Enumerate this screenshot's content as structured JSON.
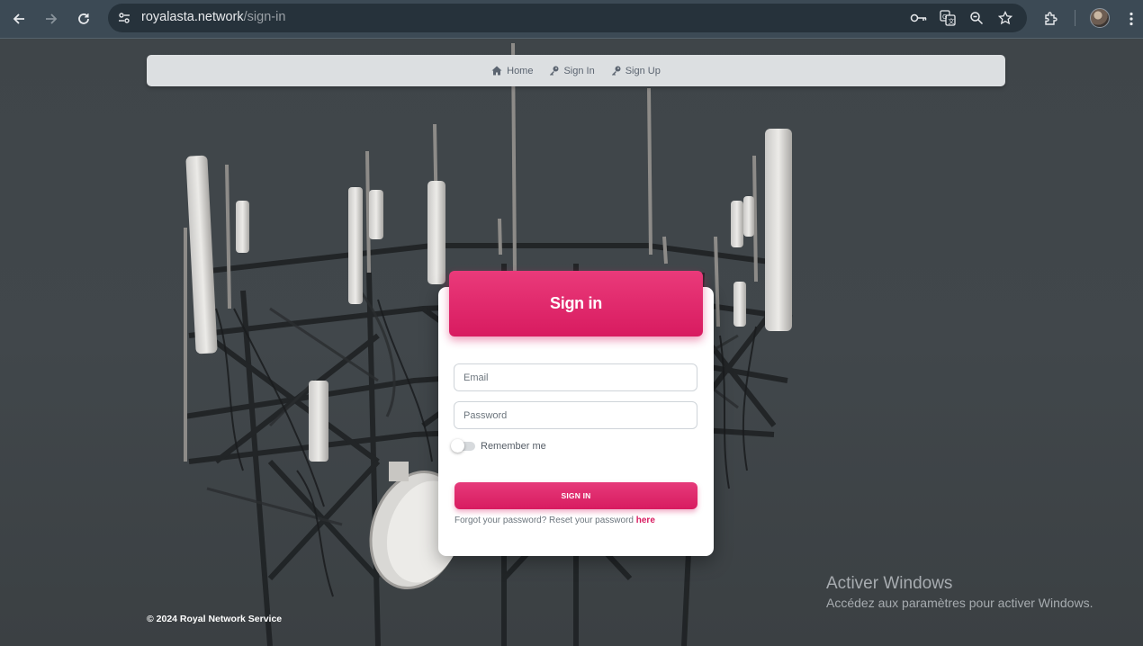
{
  "browser": {
    "url_host": "royalasta.network",
    "url_path": "/sign-in",
    "icons": [
      "back-arrow-icon",
      "forward-arrow-icon",
      "reload-icon",
      "site-settings-icon",
      "password-key-icon",
      "translate-icon",
      "zoom-icon",
      "bookmark-star-icon",
      "extensions-icon",
      "profile-avatar",
      "menu-dots-icon"
    ]
  },
  "navbar": {
    "items": [
      {
        "label": "Home",
        "icon": "home-icon"
      },
      {
        "label": "Sign In",
        "icon": "key-icon"
      },
      {
        "label": "Sign Up",
        "icon": "key-icon"
      }
    ]
  },
  "signin": {
    "title": "Sign in",
    "email_placeholder": "Email",
    "password_placeholder": "Password",
    "remember_label": "Remember me",
    "button_label": "SIGN IN",
    "forgot_text": "Forgot your password? Reset your password ",
    "forgot_link": "here"
  },
  "footer": {
    "text": "© 2024 Royal Network Service"
  },
  "watermark": {
    "title": "Activer Windows",
    "subtitle": "Accédez aux paramètres pour activer Windows."
  },
  "colors": {
    "accent": "#d81b60",
    "chrome": "#3c4a55",
    "omnibox": "#26323b"
  }
}
